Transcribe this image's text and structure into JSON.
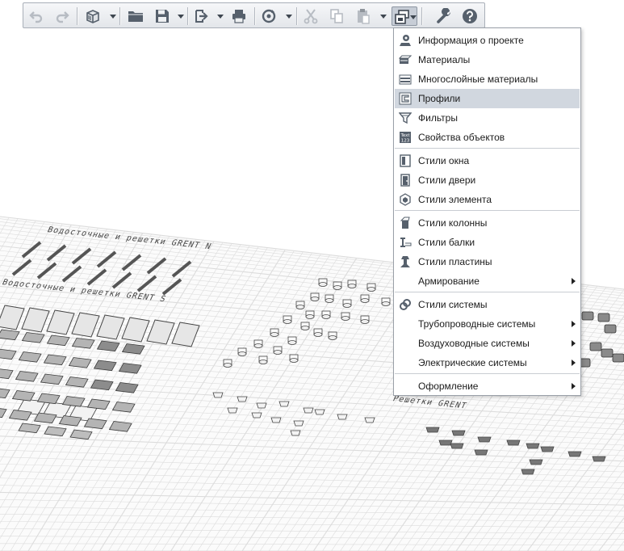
{
  "toolbar": {
    "buttons": [
      {
        "name": "undo-button",
        "icon": "undo-icon",
        "enabled": false
      },
      {
        "name": "redo-button",
        "icon": "redo-icon",
        "enabled": false
      },
      {
        "name": "new-document-button",
        "icon": "cube-new-icon",
        "enabled": true
      },
      {
        "name": "open-button",
        "icon": "folder-icon",
        "enabled": true
      },
      {
        "name": "save-button",
        "icon": "floppy-disk-icon",
        "enabled": true
      },
      {
        "name": "export-button",
        "icon": "export-icon",
        "enabled": true
      },
      {
        "name": "print-button",
        "icon": "printer-icon",
        "enabled": true
      },
      {
        "name": "sync-button",
        "icon": "sync-icon",
        "enabled": true
      },
      {
        "name": "cut-button",
        "icon": "scissors-icon",
        "enabled": false
      },
      {
        "name": "copy-button",
        "icon": "copy-icon",
        "enabled": false
      },
      {
        "name": "paste-button",
        "icon": "clipboard-icon",
        "enabled": false
      },
      {
        "name": "project-settings-button",
        "icon": "layers-settings-icon",
        "enabled": true,
        "active": true
      },
      {
        "name": "options-button",
        "icon": "wrench-icon",
        "enabled": true
      },
      {
        "name": "help-button",
        "icon": "help-icon",
        "enabled": true
      }
    ]
  },
  "menu": {
    "items": [
      {
        "label": "Информация о проекте",
        "icon": "project-info-icon"
      },
      {
        "label": "Материалы",
        "icon": "materials-icon"
      },
      {
        "label": "Многослойные материалы",
        "icon": "multilayer-materials-icon"
      },
      {
        "label": "Профили",
        "icon": "profiles-icon",
        "highlighted": true
      },
      {
        "label": "Фильтры",
        "icon": "filter-icon"
      },
      {
        "label": "Свойства объектов",
        "icon": "text-properties-icon"
      },
      {
        "label": "Стили окна",
        "icon": "window-style-icon"
      },
      {
        "label": "Стили двери",
        "icon": "door-style-icon"
      },
      {
        "label": "Стили элемента",
        "icon": "element-style-icon"
      },
      {
        "label": "Стили колонны",
        "icon": "column-style-icon"
      },
      {
        "label": "Стили балки",
        "icon": "beam-style-icon"
      },
      {
        "label": "Стили пластины",
        "icon": "plate-style-icon"
      },
      {
        "label": "Армирование",
        "submenu": true
      },
      {
        "label": "Стили системы",
        "icon": "system-style-icon"
      },
      {
        "label": "Трубопроводные системы",
        "submenu": true
      },
      {
        "label": "Воздуховодные системы",
        "submenu": true
      },
      {
        "label": "Электрические системы",
        "submenu": true
      },
      {
        "label": "Оформление",
        "submenu": true
      }
    ]
  },
  "viewport": {
    "labels": {
      "group_north": "Водосточные и решетки GRENT N",
      "group_s": "Водосточные и решетки GRENT S",
      "group_grates": "Решетки GRENT"
    }
  },
  "colors": {
    "toolbar_icon": "#56606c",
    "toolbar_icon_disabled": "#b7bcc3",
    "menu_highlight": "#d1d7df",
    "grid_line": "#dcdcdc"
  }
}
